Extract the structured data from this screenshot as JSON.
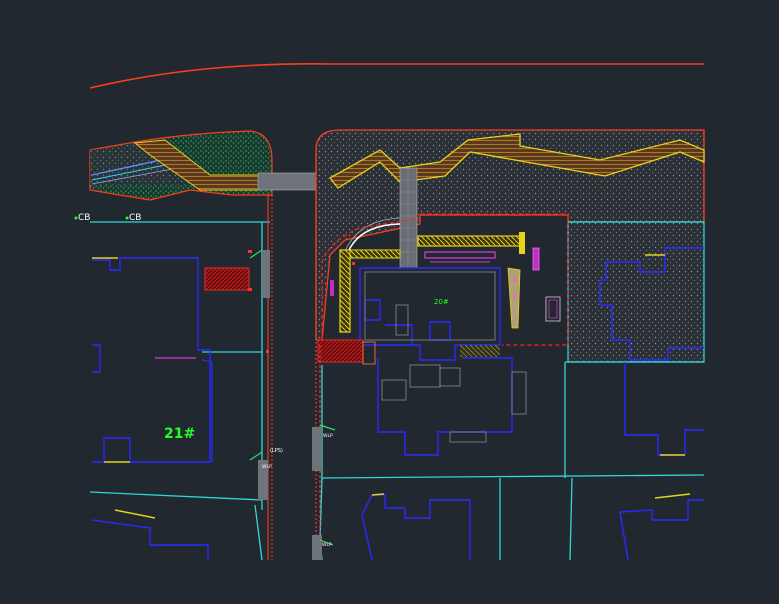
{
  "colors": {
    "background": "#212830",
    "road_red": "#ff3c1e",
    "boundary_cyan": "#30d8d8",
    "building_blue": "#2a2aff",
    "paving_yellow": "#e8d21a",
    "paving_brown": "#a0642a",
    "planting_green": "#1e7a46",
    "gravel_gray": "#555a62",
    "magenta": "#e040e0",
    "dark_red": "#8b1010",
    "white": "#ffffff",
    "label_green": "#22ff22"
  },
  "labels": {
    "cb_1": "CB",
    "cb_2": "CB",
    "building_21": "21#",
    "building_small": "20#",
    "lps": "(LPS)",
    "tag_1": "WLP",
    "tag_2": "WLP",
    "tag_3": "WLP"
  }
}
